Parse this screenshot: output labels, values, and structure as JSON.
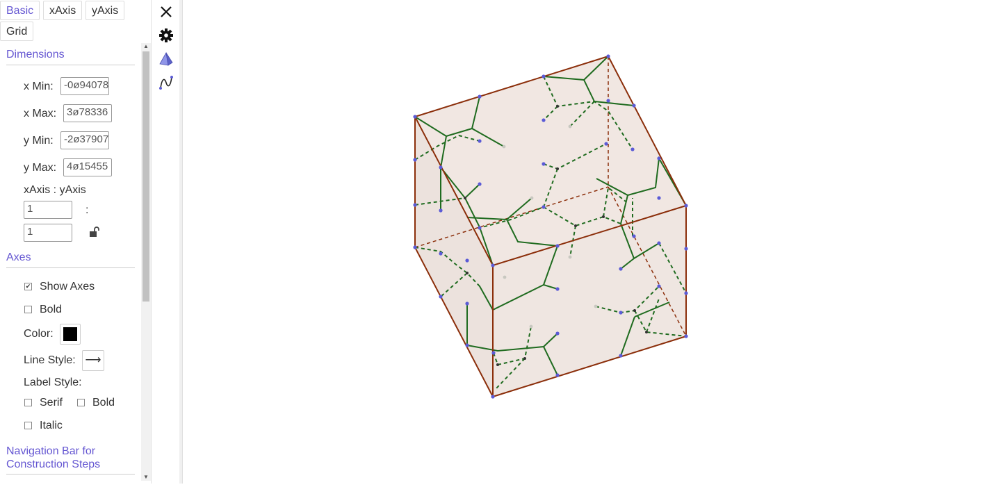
{
  "tabs": [
    {
      "label": "Basic",
      "active": true
    },
    {
      "label": "xAxis",
      "active": false
    },
    {
      "label": "yAxis",
      "active": false
    },
    {
      "label": "Grid",
      "active": false
    }
  ],
  "toolbar": {
    "close_icon": "close-icon",
    "settings_icon": "gear-icon",
    "view3d_icon": "pyramid-icon",
    "graphics_icon": "curve-icon"
  },
  "dimensions": {
    "title": "Dimensions",
    "x_min_label": "x Min:",
    "x_min_value": "-0ø94078",
    "x_max_label": "x Max:",
    "x_max_value": "3ø78336",
    "y_min_label": "y Min:",
    "y_min_value": "-2ø37907",
    "y_max_label": "y Max:",
    "y_max_value": "4ø15455",
    "ratio_label": "xAxis : yAxis",
    "ratio_x": "1",
    "ratio_colon": ":",
    "ratio_y": "1",
    "lock_icon": "unlock-icon"
  },
  "axes": {
    "title": "Axes",
    "show_axes_label": "Show Axes",
    "show_axes_checked": true,
    "bold_label": "Bold",
    "bold_checked": false,
    "color_label": "Color:",
    "color_value": "#000000",
    "line_style_label": "Line Style:",
    "line_style_glyph": "⟶",
    "label_style_label": "Label Style:",
    "serif_label": "Serif",
    "label_bold_label": "Bold",
    "italic_label": "Italic"
  },
  "navigation": {
    "title_line1": "Navigation Bar for",
    "title_line2": "Construction Steps"
  },
  "colors": {
    "accent": "#6557d2",
    "cube_edge": "#8b2e0a",
    "cube_face": "#efe4df",
    "tree_line": "#1f6b1f",
    "point": "#5b5bd6"
  }
}
